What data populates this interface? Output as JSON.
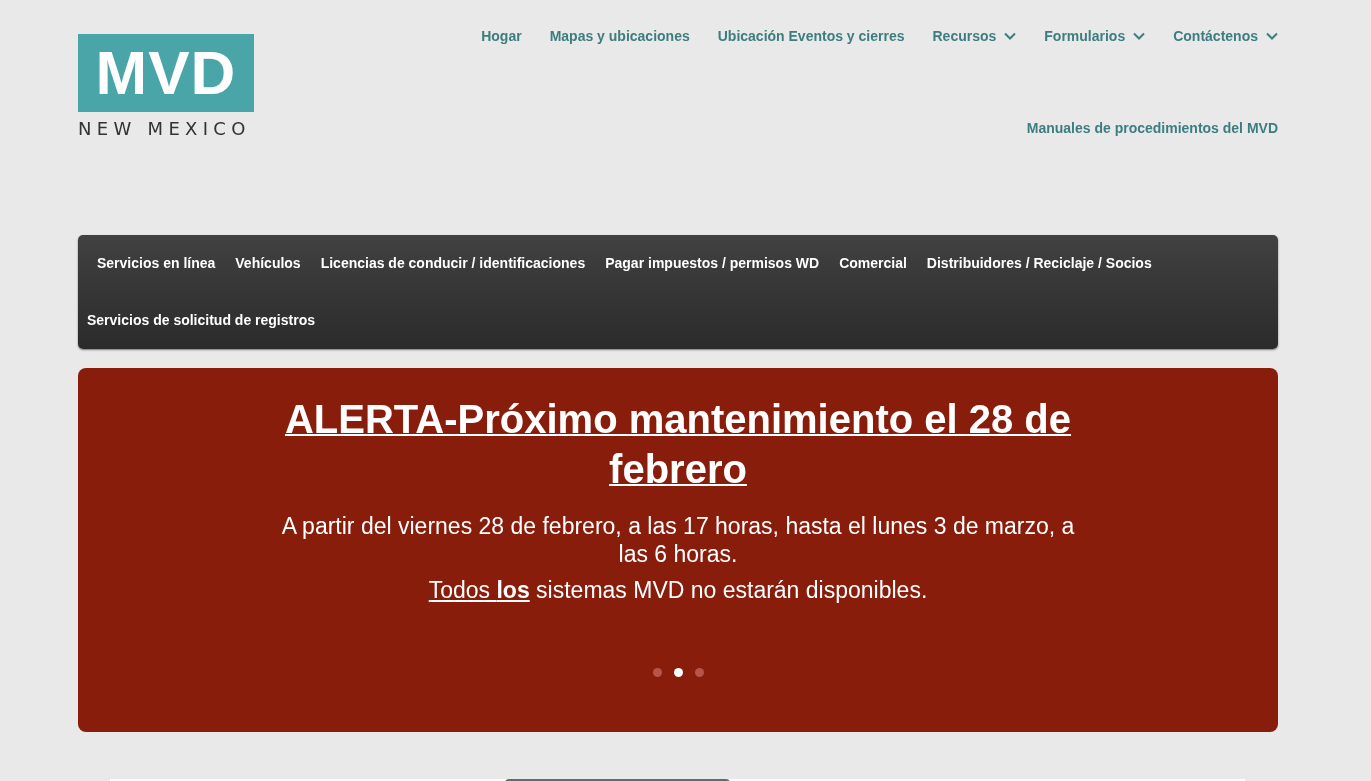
{
  "logo": {
    "mark": "MVD",
    "subtitle": "NEW MEXICO"
  },
  "top_nav": [
    {
      "label": "Hogar",
      "has_dropdown": false
    },
    {
      "label": "Mapas y ubicaciones",
      "has_dropdown": false
    },
    {
      "label": "Ubicación Eventos y cierres",
      "has_dropdown": false
    },
    {
      "label": "Recursos",
      "has_dropdown": true
    },
    {
      "label": "Formularios",
      "has_dropdown": true
    },
    {
      "label": "Contáctenos",
      "has_dropdown": true
    }
  ],
  "secondary_link": "Manuales de procedimientos del MVD",
  "main_menu": [
    {
      "label": "Servicios en línea"
    },
    {
      "label": "Vehículos"
    },
    {
      "label": "Licencias de conducir / identificaciones"
    },
    {
      "label": "Pagar impuestos / permisos WD"
    },
    {
      "label": "Comercial"
    },
    {
      "label": "Distribuidores / Reciclaje / Socios"
    },
    {
      "label": "Servicios de solicitud de registros"
    }
  ],
  "alert": {
    "title": "ALERTA-Próximo mantenimiento el 28 de febrero",
    "body": "A partir del viernes 28 de febrero, a las 17 horas, hasta el lunes 3 de marzo, a las 6 horas.",
    "notice_emphasis": "Todos **los**",
    "notice_rest": " sistemas MVD no estarán disponibles.",
    "slides": [
      {
        "selected": false
      },
      {
        "selected": true
      },
      {
        "selected": false
      }
    ]
  }
}
